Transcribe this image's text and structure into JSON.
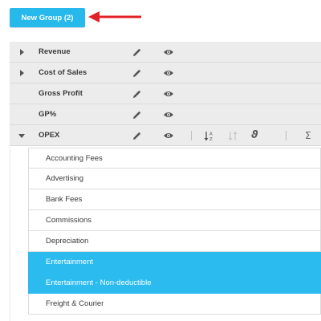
{
  "toolbar": {
    "new_group_label": "New Group (2)"
  },
  "colors": {
    "accent": "#27b9ec",
    "selected": "#2bbbee",
    "arrow": "#e32026",
    "row_bg": "#ececec"
  },
  "groups": [
    {
      "label": "Revenue",
      "caret": "right",
      "icons": [
        "pencil-icon",
        "eye-icon"
      ]
    },
    {
      "label": "Cost of Sales",
      "caret": "right",
      "icons": [
        "pencil-icon",
        "eye-icon"
      ]
    },
    {
      "label": "Gross Profit",
      "caret": "none",
      "icons": [
        "pencil-icon",
        "eye-icon"
      ]
    },
    {
      "label": "GP%",
      "caret": "none",
      "icons": [
        "pencil-icon",
        "eye-icon"
      ]
    },
    {
      "label": "OPEX",
      "caret": "down",
      "icons": [
        "pencil-icon",
        "eye-icon",
        "sort-az-icon",
        "sort-za-icon",
        "theta-icon",
        "sigma-icon"
      ]
    }
  ],
  "opex": {
    "tools": {
      "theta": "ϑ",
      "sigma": "Σ"
    },
    "items": [
      {
        "label": "Accounting Fees",
        "selected": false
      },
      {
        "label": "Advertising",
        "selected": false
      },
      {
        "label": "Bank Fees",
        "selected": false
      },
      {
        "label": "Commissions",
        "selected": false
      },
      {
        "label": "Depreciation",
        "selected": false
      },
      {
        "label": "Entertainment",
        "selected": true
      },
      {
        "label": "Entertainment - Non-deductible",
        "selected": true
      },
      {
        "label": "Freight & Courier",
        "selected": false
      }
    ]
  }
}
